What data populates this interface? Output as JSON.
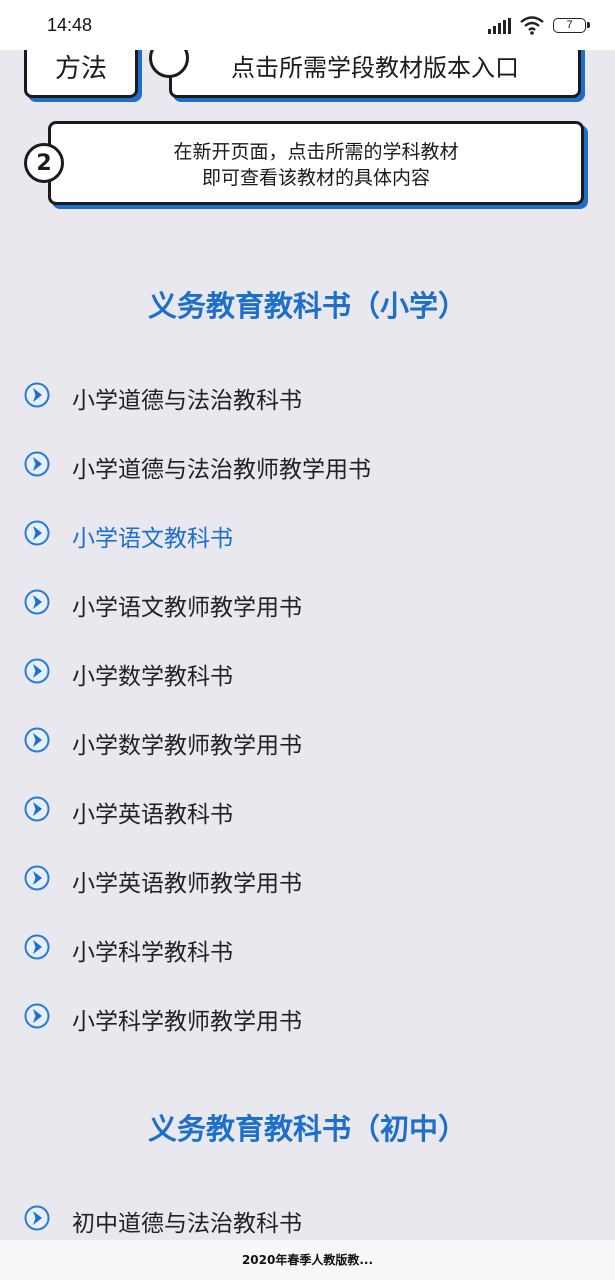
{
  "status_bar": {
    "time": "14:48",
    "battery": "7"
  },
  "guide": {
    "method_label": "方法",
    "step1_text": "点击所需学段教材版本入口",
    "step2_num": "2",
    "step2_line1": "在新开页面，点击所需的学科教材",
    "step2_line2": "即可查看该教材的具体内容"
  },
  "sections": [
    {
      "title": "义务教育教科书（小学）",
      "items": [
        "小学道德与法治教科书",
        "小学道德与法治教师教学用书",
        "小学语文教科书",
        "小学语文教师教学用书",
        "小学数学教科书",
        "小学数学教师教学用书",
        "小学英语教科书",
        "小学英语教师教学用书",
        "小学科学教科书",
        "小学科学教师教学用书"
      ]
    },
    {
      "title": "义务教育教科书（初中）",
      "items": [
        "初中道德与法治教科书"
      ]
    }
  ],
  "colors": {
    "accent": "#1d6fca",
    "background": "#e9e8ee",
    "box_shadow": "#1e6fc9"
  },
  "bottom_bar": {
    "title": "2020年春季人教版教..."
  }
}
